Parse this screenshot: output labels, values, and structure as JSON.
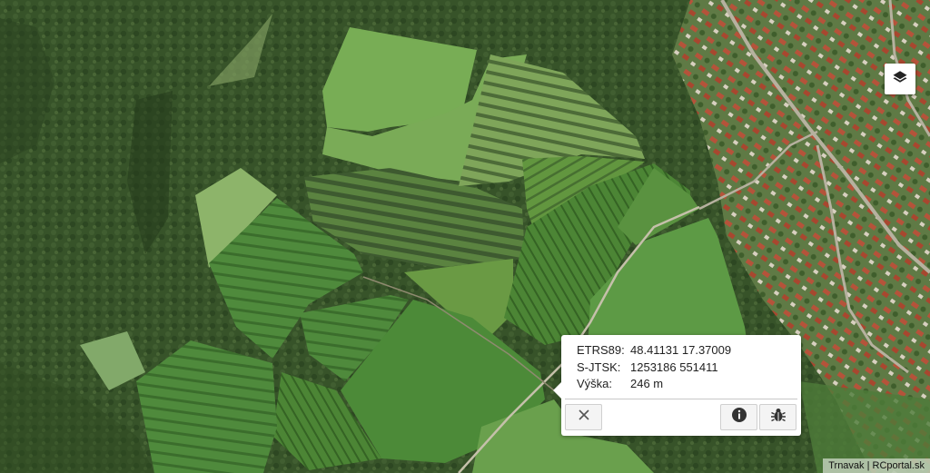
{
  "map": {
    "type": "satellite"
  },
  "controls": {
    "layers_icon": "layers-icon"
  },
  "popup": {
    "rows": [
      {
        "label": "ETRS89:",
        "value": "48.41131 17.37009"
      },
      {
        "label": "S-JTSK:",
        "value": "1253186 551411"
      },
      {
        "label": "Výška:",
        "value": "246 m"
      }
    ],
    "buttons": {
      "close_icon": "close-icon",
      "info_icon": "info-icon",
      "bug_icon": "bug-icon"
    }
  },
  "attribution": {
    "text": "Trnavak",
    "separator": " | ",
    "link": "RCportal.sk"
  }
}
